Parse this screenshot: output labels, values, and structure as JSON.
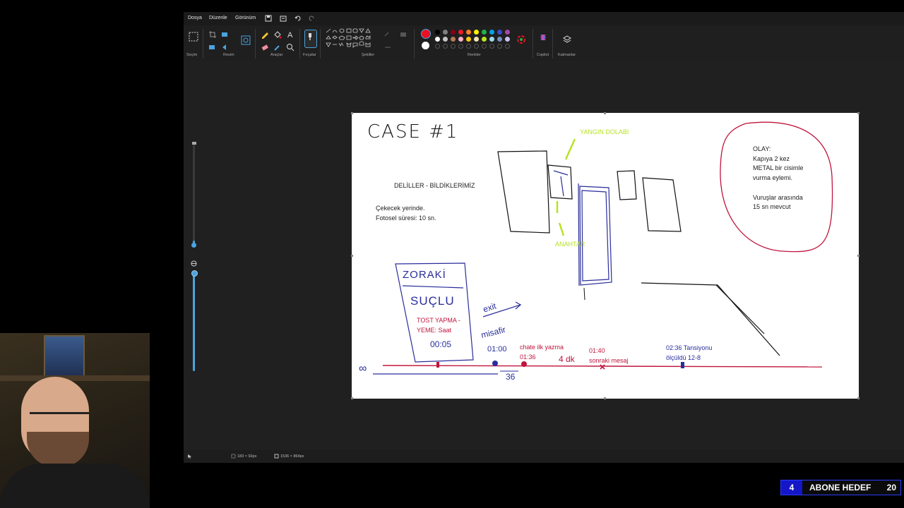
{
  "menu": {
    "file": "Dosya",
    "edit": "Düzenle",
    "view": "Görünüm"
  },
  "ribbon": {
    "groups": {
      "selection": "Seçim",
      "image": "Resim",
      "tools": "Araçlar",
      "brushes": "Fırçalar",
      "shapes": "Şekiller",
      "colors": "Renkler",
      "copilot": "Copilot",
      "layers": "Katmanlar"
    },
    "selected_color": "#e81123",
    "secondary_color": "#ffffff",
    "palette_row1": [
      "#000000",
      "#7f7f7f",
      "#880015",
      "#ed1c24",
      "#ff7f27",
      "#fff200",
      "#22b14c",
      "#00a2e8",
      "#3f48cc",
      "#a349a4"
    ],
    "palette_row2": [
      "#ffffff",
      "#c3c3c3",
      "#b97a57",
      "#ffaec9",
      "#ffc90e",
      "#efe4b0",
      "#b5e61d",
      "#99d9ea",
      "#7092be",
      "#c8bfe7"
    ]
  },
  "canvas_text": {
    "title": "CASE #1",
    "evidence_heading": "DELİLLER - BİLDİKLERİMİZ",
    "evidence_lines": "Çekecek yerinde.\nFotosel süresi: 10 sn.",
    "yangin": "YANGIN DOLABI",
    "anahtar": "ANAHTAR",
    "olay": "OLAY:\nKapıya 2 kez\nMETAL bir cisimle\nvurma eylemi.\n\nVuruşlar arasında\n15 sn mevcut",
    "zoraki": "ZORAKİ",
    "suclu": "SUÇLU",
    "tost": "TOST YAPMA -\nYEME: Saat",
    "tost_time": "00:05",
    "exit": "exit",
    "misafir": "misafir",
    "misafir_time": "01:00",
    "chate": "chate ilk yazma\n01:36",
    "sonraki": "01:40\nsonraki mesaj",
    "tansiyon": "02:36 Tansiyonu\nölçüldü 12-8",
    "ndk": "4 dk",
    "infinity": "∞",
    "tick36": "36"
  },
  "status": {
    "selection_size": "183 × 92px",
    "canvas_size": "1536 × 864px"
  },
  "goal": {
    "count": "4",
    "label": "ABONE HEDEF",
    "target": "20"
  }
}
